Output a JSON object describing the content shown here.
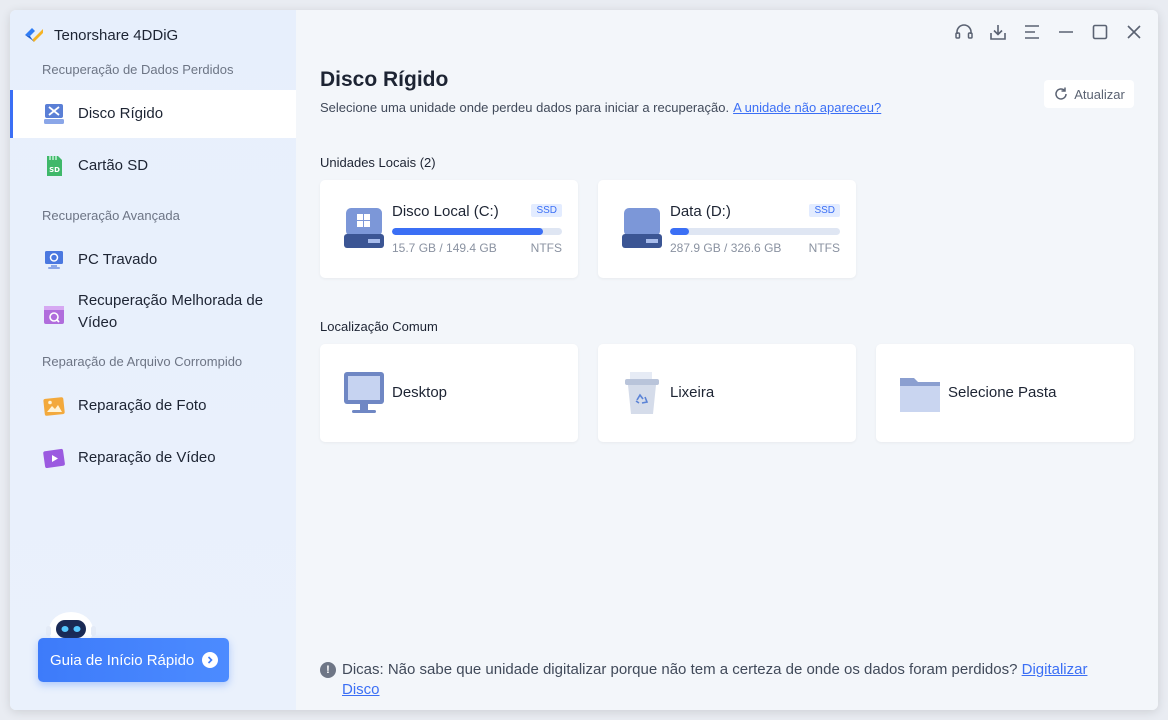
{
  "app": {
    "title": "Tenorshare 4DDiG"
  },
  "sidebar": {
    "sections": [
      {
        "label": "Recuperação de Dados Perdidos"
      },
      {
        "label": "Recuperação Avançada"
      },
      {
        "label": "Reparação de Arquivo Corrompido"
      }
    ],
    "items": [
      {
        "label": "Disco Rígido",
        "icon": "hard-drive-icon",
        "active": true
      },
      {
        "label": "Cartão SD",
        "icon": "sd-card-icon"
      },
      {
        "label": "PC Travado",
        "icon": "crashed-pc-icon"
      },
      {
        "label": "Recuperação Melhorada de Vídeo",
        "icon": "video-enhance-icon"
      },
      {
        "label": "Reparação de Foto",
        "icon": "photo-repair-icon"
      },
      {
        "label": "Reparação de Vídeo",
        "icon": "video-repair-icon"
      }
    ],
    "guide_button": "Guia de Início Rápido"
  },
  "main": {
    "title": "Disco Rígido",
    "subtitle": "Selecione uma unidade onde perdeu dados para iniciar a recuperação.",
    "subtitle_link": "A unidade não apareceu?",
    "refresh_label": "Atualizar",
    "local_units_label": "Unidades Locais (2)",
    "drives": [
      {
        "name": "Disco Local (C:)",
        "badge": "SSD",
        "size": "15.7 GB / 149.4 GB",
        "fs": "NTFS",
        "used_fraction": 0.89
      },
      {
        "name": "Data (D:)",
        "badge": "SSD",
        "size": "287.9 GB / 326.6 GB",
        "fs": "NTFS",
        "used_fraction": 0.11
      }
    ],
    "common_label": "Localização Comum",
    "locations": [
      {
        "name": "Desktop",
        "icon": "monitor-icon"
      },
      {
        "name": "Lixeira",
        "icon": "recycle-bin-icon"
      },
      {
        "name": "Selecione Pasta",
        "icon": "folder-icon"
      }
    ],
    "tip_text": "Dicas: Não sabe que unidade digitalizar porque não tem a certeza de onde os dados foram perdidos?",
    "tip_link": "Digitalizar Disco"
  },
  "colors": {
    "accent": "#3b6ff5",
    "sidebar_bg": "#e7effc",
    "main_bg": "#f3f6fa"
  }
}
